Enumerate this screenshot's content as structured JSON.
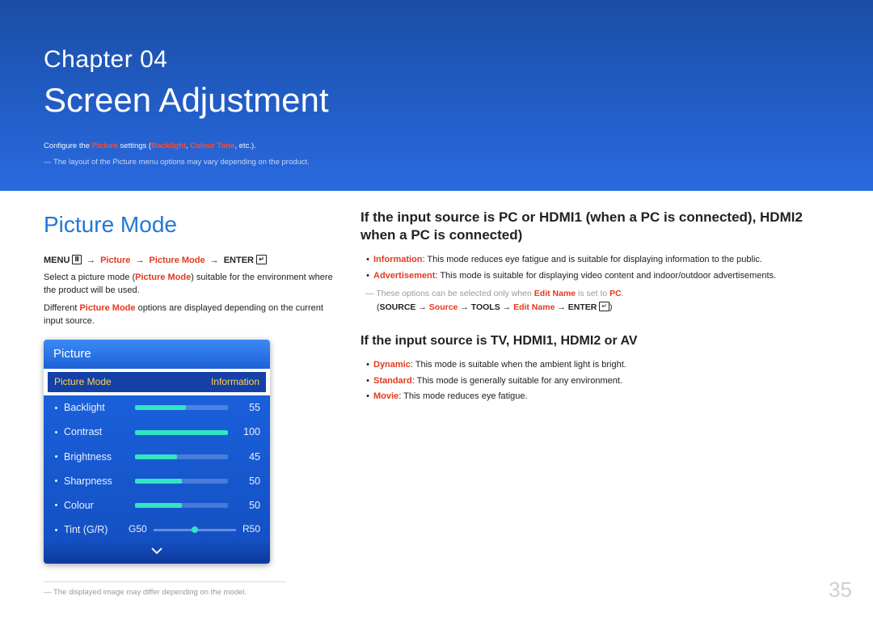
{
  "chapter": {
    "label": "Chapter  04",
    "title": "Screen Adjustment",
    "config_pre": "Configure the ",
    "config_picture": "Picture",
    "config_mid": " settings (",
    "config_backlight": "Backlight",
    "config_sep": ", ",
    "config_colourtone": "Colour Tone",
    "config_post": ", etc.).",
    "note_pre": "― The layout of the ",
    "note_picture": "Picture",
    "note_post": " menu options may vary depending on the product."
  },
  "left": {
    "section_title": "Picture Mode",
    "bc_menu": "MENU",
    "bc_menu_icon": "Ⅲ",
    "bc_picture": "Picture",
    "bc_picture_mode": "Picture Mode",
    "bc_enter": "ENTER",
    "bc_enter_icon": "↵",
    "arrow": "→",
    "para1_pre": "Select a picture mode (",
    "para1_pm": "Picture Mode",
    "para1_post": ") suitable for the environment where the product will be used.",
    "para2_pre": "Different ",
    "para2_pm": "Picture Mode",
    "para2_post": " options are displayed depending on the current input source.",
    "foot": "― The displayed image may differ depending on the model."
  },
  "osd": {
    "title": "Picture",
    "mode_label": "Picture Mode",
    "mode_value": "Information",
    "items": [
      {
        "label": "Backlight",
        "value": "55",
        "pct": 55
      },
      {
        "label": "Contrast",
        "value": "100",
        "pct": 100
      },
      {
        "label": "Brightness",
        "value": "45",
        "pct": 45
      },
      {
        "label": "Sharpness",
        "value": "50",
        "pct": 50
      },
      {
        "label": "Colour",
        "value": "50",
        "pct": 50
      }
    ],
    "tint_label": "Tint (G/R)",
    "tint_left": "G50",
    "tint_right": "R50"
  },
  "right": {
    "h2": "If the input source is PC or HDMI1 (when a PC is connected), HDMI2 when a PC is connected)",
    "bl1_name": "Information",
    "bl1_text": ": This mode reduces eye fatigue and is suitable for displaying information to the public.",
    "bl2_name": "Advertisement",
    "bl2_text": ": This mode is suitable for displaying video content and indoor/outdoor advertisements.",
    "note_pre": "― These options can be selected only when ",
    "note_editname": "Edit Name",
    "note_mid": " is set to ",
    "note_pc": "PC",
    "note_post": ".",
    "src_open": "(",
    "src_source_lbl": "SOURCE",
    "src_arrow": "→",
    "src_source": "Source",
    "src_tools": "TOOLS",
    "src_editname": "Edit Name",
    "src_enter": "ENTER",
    "src_enter_icon": "↵",
    "src_close": ")",
    "h2b": "If the input source is TV, HDMI1, HDMI2 or AV",
    "bl3_name": "Dynamic",
    "bl3_text": ": This mode is suitable when the ambient light is bright.",
    "bl4_name": "Standard",
    "bl4_text": ": This mode is generally suitable for any environment.",
    "bl5_name": "Movie",
    "bl5_text": ": This mode reduces eye fatigue."
  },
  "page_number": "35"
}
